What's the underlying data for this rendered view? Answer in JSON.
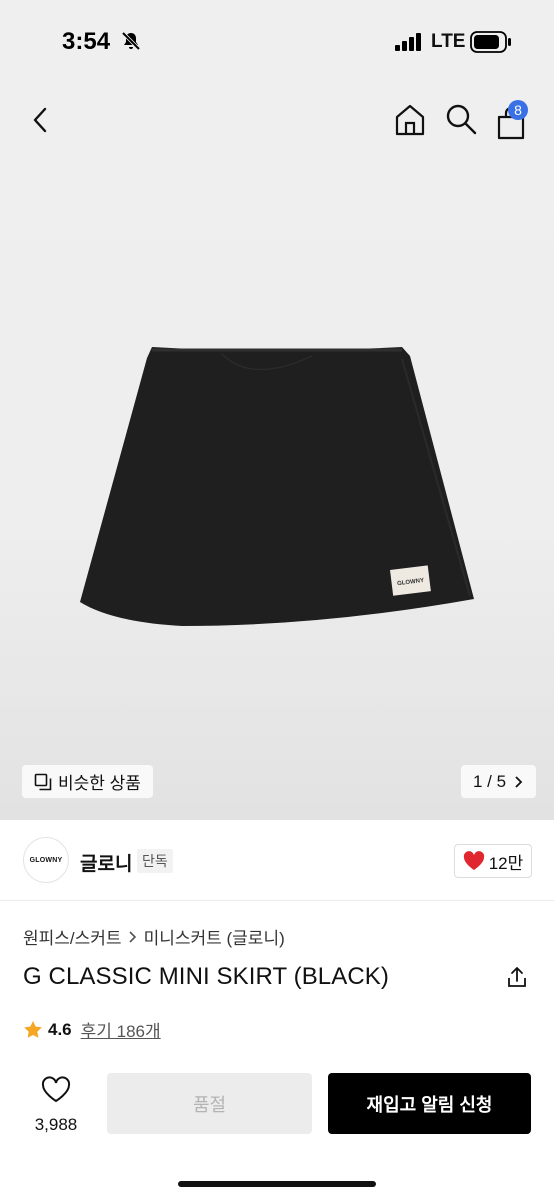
{
  "status": {
    "time": "3:54",
    "network": "LTE"
  },
  "nav": {
    "cart_count": "8"
  },
  "gallery": {
    "similar_label": "비슷한 상품",
    "page_indicator": "1 / 5"
  },
  "brand": {
    "logo_text": "GLOWNY",
    "name": "글로니",
    "tag": "단독",
    "like_count": "12만"
  },
  "breadcrumb": {
    "category": "원피스/스커트",
    "subcategory": "미니스커트 (글로니)"
  },
  "product": {
    "title": "G CLASSIC MINI SKIRT (BLACK)",
    "rating": "4.6",
    "reviews": "후기 186개",
    "label_text": "GLOWNY"
  },
  "footer": {
    "wish_count": "3,988",
    "soldout_label": "품절",
    "restock_label": "재입고 알림 신청"
  },
  "colors": {
    "accent": "#3a70e6",
    "like": "#e0262f",
    "star": "#f5a623",
    "cta": "#000000"
  }
}
